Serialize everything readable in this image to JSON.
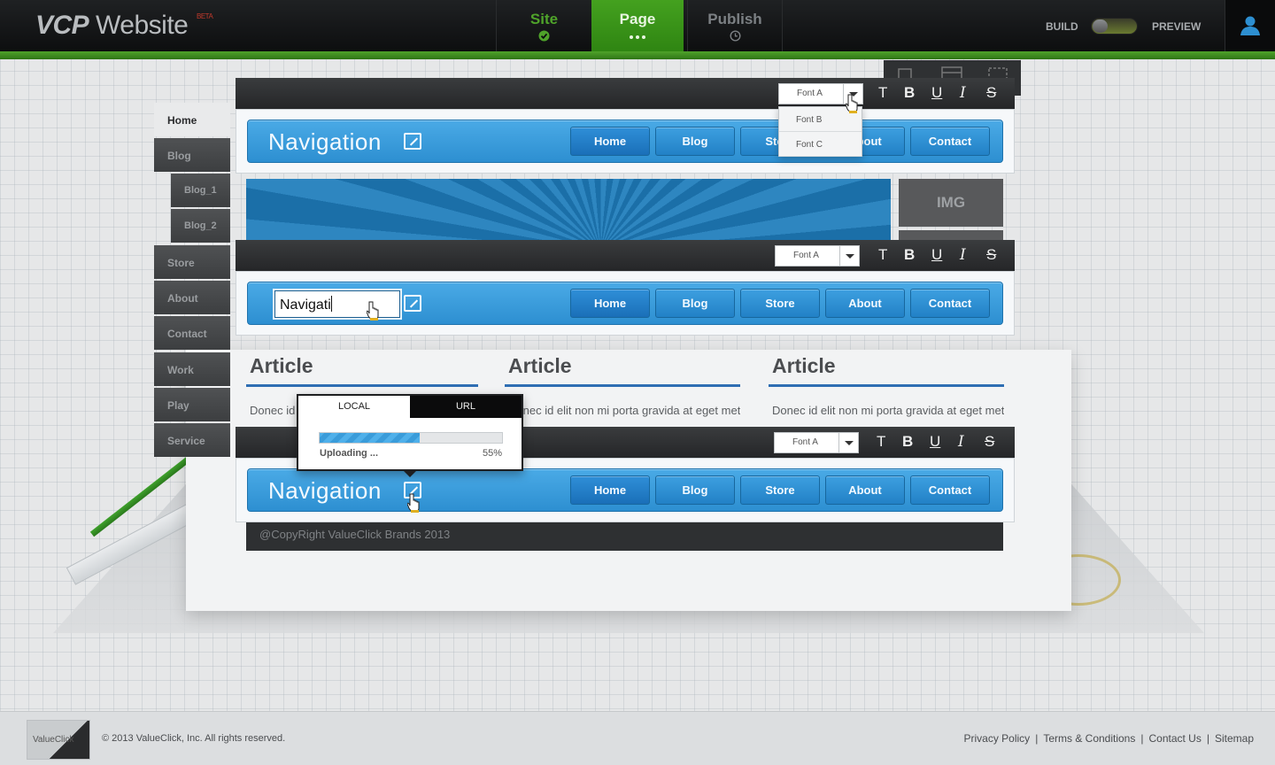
{
  "app": {
    "brand": "VCP",
    "brand_rest": "Website",
    "beta": "BETA",
    "tabs": [
      {
        "label": "Site",
        "state": "done"
      },
      {
        "label": "Page",
        "state": "active"
      },
      {
        "label": "Publish",
        "state": "pending"
      }
    ],
    "mode_build": "BUILD",
    "mode_preview": "PREVIEW"
  },
  "sidebar": {
    "items": [
      {
        "label": "Home",
        "active": true
      },
      {
        "label": "Blog"
      },
      {
        "label": "Blog_1",
        "sub": true
      },
      {
        "label": "Blog_2",
        "sub": true
      },
      {
        "label": "Store"
      },
      {
        "label": "About"
      },
      {
        "label": "Contact"
      },
      {
        "label": "Work"
      },
      {
        "label": "Play"
      },
      {
        "label": "Service"
      }
    ]
  },
  "toolbar": {
    "font_selected": "Font A",
    "font_options": [
      "Font B",
      "Font C"
    ],
    "format_buttons": [
      "T",
      "B",
      "U",
      "I",
      "S"
    ]
  },
  "nav": {
    "title": "Navigation",
    "edit_value": "Navigati",
    "buttons": [
      "Home",
      "Blog",
      "Store",
      "About",
      "Contact"
    ]
  },
  "content": {
    "img_placeholder": "IMG",
    "articles": [
      {
        "title": "Article",
        "text": "Donec id elit non mi porta gravida at eget metus. Fusce dapibus, tellus ac cursus"
      },
      {
        "title": "Article",
        "text": "Donec id elit non mi porta gravida at eget metus. Fusce dapibus, tellus ac cursus"
      },
      {
        "title": "Article",
        "text": "Donec id elit non mi porta gravida at eget metus. Fusce dapibus, tellus ac cursus"
      }
    ],
    "copyright": "@CopyRight ValueClick Brands 2013"
  },
  "upload": {
    "tab_local": "LOCAL",
    "tab_url": "URL",
    "status": "Uploading ...",
    "percent_label": "55%",
    "progress": 0.55
  },
  "footer": {
    "logo": "ValueClick",
    "copyright": "© 2013 ValueClick, Inc. All rights reserved.",
    "links": [
      "Privacy Policy",
      "Terms & Conditions",
      "Contact Us",
      "Sitemap"
    ]
  },
  "colors": {
    "accent_green": "#4fa32a",
    "nav_blue": "#2d8fd1",
    "article_rule": "#2f6eb3"
  }
}
